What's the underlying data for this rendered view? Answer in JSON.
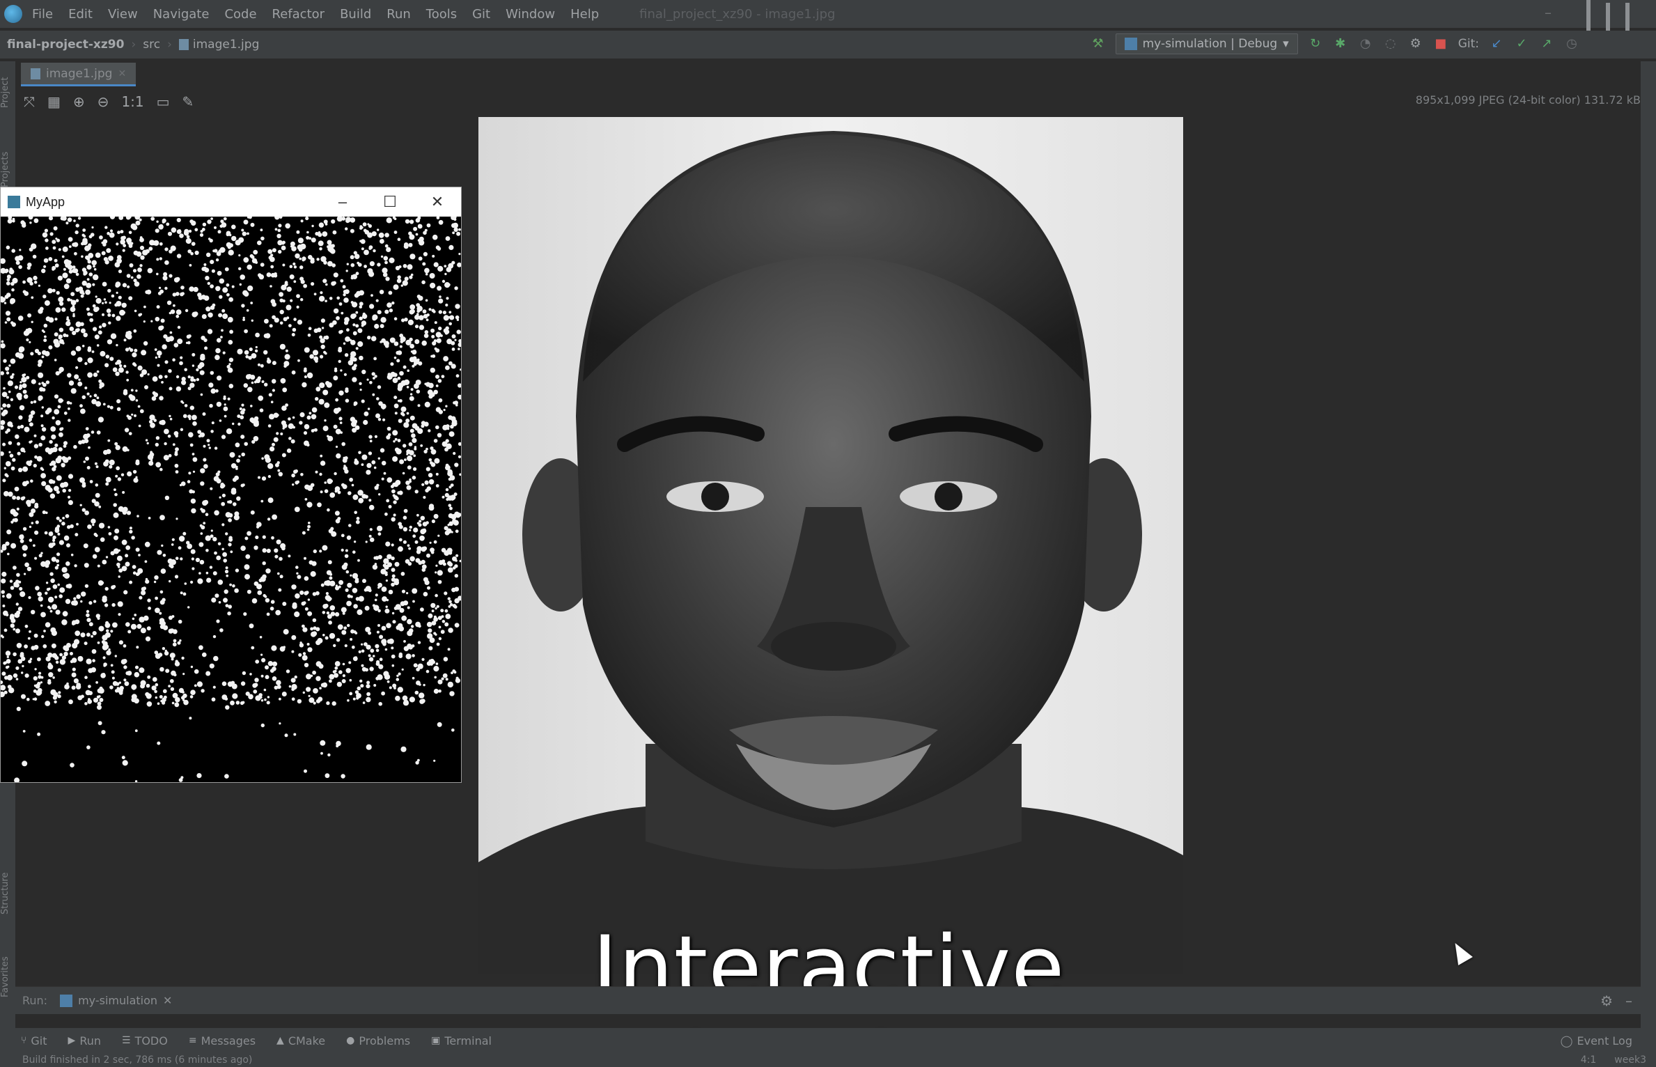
{
  "menubar": {
    "items": [
      "File",
      "Edit",
      "View",
      "Navigate",
      "Code",
      "Refactor",
      "Build",
      "Run",
      "Tools",
      "Git",
      "Window",
      "Help"
    ],
    "window_title": "final_project_xz90 - image1.jpg"
  },
  "navbar": {
    "project": "final-project-xz90",
    "folder": "src",
    "file": "image1.jpg",
    "run_config": "my-simulation | Debug",
    "git_label": "Git:"
  },
  "editor": {
    "tab_label": "image1.jpg",
    "image_info": "895x1,099 JPEG (24-bit color) 131.72 kB"
  },
  "left_tool_tabs": [
    "Project",
    "Projects",
    "Structure",
    "Favorites"
  ],
  "myapp": {
    "title": "MyApp"
  },
  "run_panel": {
    "label": "Run:",
    "tab": "my-simulation"
  },
  "bottom_tools": [
    {
      "icon": "git-icon",
      "label": "Git"
    },
    {
      "icon": "run-icon",
      "label": "Run"
    },
    {
      "icon": "todo-icon",
      "label": "TODO"
    },
    {
      "icon": "messages-icon",
      "label": "Messages"
    },
    {
      "icon": "cmake-icon",
      "label": "CMake"
    },
    {
      "icon": "problems-icon",
      "label": "Problems"
    },
    {
      "icon": "terminal-icon",
      "label": "Terminal"
    }
  ],
  "event_log": "Event Log",
  "status": {
    "message": "Build finished in 2 sec, 786 ms (6 minutes ago)",
    "position": "4:1",
    "branch": "week3"
  },
  "caption": "Interactive drawing",
  "colors": {
    "ide_bg": "#2b2b2b",
    "panel_bg": "#3c3f41",
    "accent": "#4a88c7"
  }
}
